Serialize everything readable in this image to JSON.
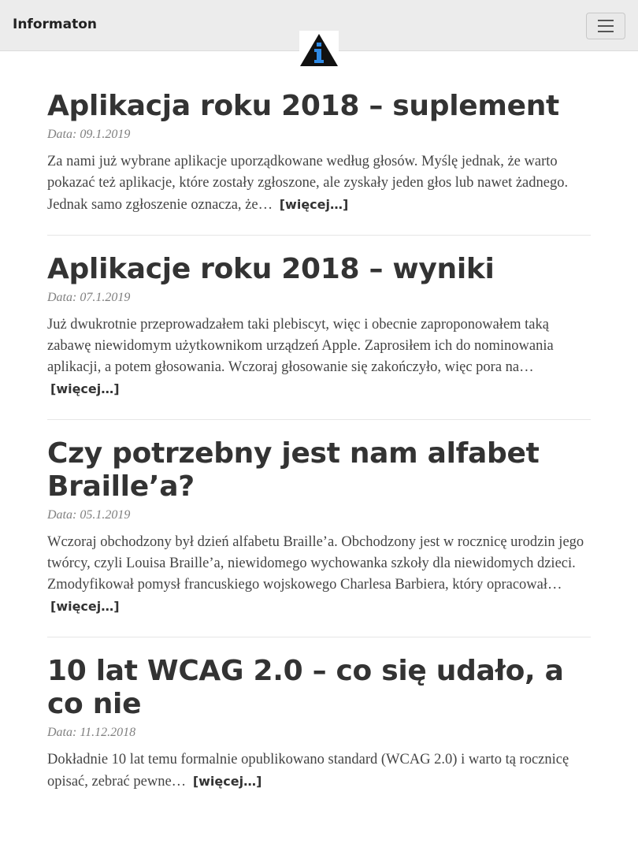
{
  "navbar": {
    "brand": "Informaton",
    "logo_icon": "info-triangle-icon",
    "logo_colors": {
      "triangle": "#111111",
      "letter": "#2e8ae6"
    },
    "menu_icon": "hamburger-icon"
  },
  "posts": [
    {
      "title": "Aplikacja roku 2018 – suplement",
      "date_label": "Data:",
      "date": "09.1.2019",
      "excerpt": "Za nami już wybrane aplikacje uporządkowane według głosów. Myślę jednak, że warto pokazać też aplikacje, które zostały zgłoszone, ale zyskały jeden głos lub nawet żadnego. Jednak samo zgłoszenie oznacza, że…",
      "more": "[więcej…]"
    },
    {
      "title": "Aplikacje roku 2018 – wyniki",
      "date_label": "Data:",
      "date": "07.1.2019",
      "excerpt": "Już dwukrotnie przeprowadzałem taki plebiscyt, więc i obecnie zaproponowałem taką zabawę niewidomym użytkownikom urządzeń Apple. Zaprosiłem ich do nominowania aplikacji, a potem głosowania. Wczoraj głosowanie się zakończyło, więc pora na…",
      "more": "[więcej…]"
    },
    {
      "title": "Czy potrzebny jest nam alfabet Braille’a?",
      "date_label": "Data:",
      "date": "05.1.2019",
      "excerpt": "Wczoraj obchodzony był dzień alfabetu Braille’a. Obchodzony jest w rocznicę urodzin jego twórcy, czyli Louisa Braille’a, niewidomego wychowanka szkoły dla niewidomych dzieci. Zmodyfikował pomysł francuskiego wojskowego Charlesa Barbiera, który opracował…",
      "more": "[więcej…]"
    },
    {
      "title": "10 lat WCAG 2.0 – co się udało, a co nie",
      "date_label": "Data:",
      "date": "11.12.2018",
      "excerpt": "Dokładnie 10 lat temu formalnie opublikowano standard (WCAG 2.0) i warto tą rocznicę opisać, zebrać pewne…",
      "more": "[więcej…]"
    }
  ]
}
